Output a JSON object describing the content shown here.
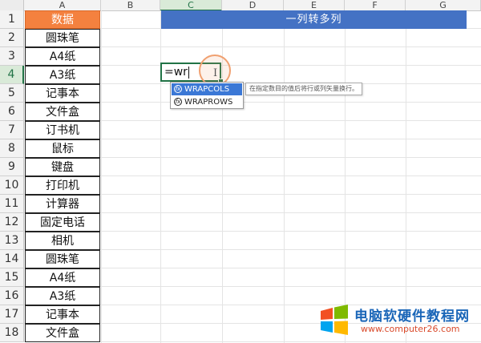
{
  "columns": [
    "A",
    "B",
    "C",
    "D",
    "E",
    "F",
    "G"
  ],
  "active_column": "C",
  "rows": [
    "1",
    "2",
    "3",
    "4",
    "5",
    "6",
    "7",
    "8",
    "9",
    "10",
    "11",
    "12",
    "13",
    "14",
    "15",
    "16",
    "17",
    "18"
  ],
  "active_row": "4",
  "column_a": [
    "数据",
    "圆珠笔",
    "A4纸",
    "A3纸",
    "记事本",
    "文件盒",
    "订书机",
    "鼠标",
    "键盘",
    "打印机",
    "计算器",
    "固定电话",
    "相机",
    "圆珠笔",
    "A4纸",
    "A3纸",
    "记事本",
    "文件盒"
  ],
  "title_bar": "一列转多列",
  "formula_input": "=wr",
  "autocomplete": {
    "items": [
      "WRAPCOLS",
      "WRAPROWS"
    ],
    "selected_index": 0,
    "icon_glyph": "fx",
    "tooltip": "在指定数目的值后将行或列矢量换行。"
  },
  "watermark": {
    "title": "电脑软硬件教程网",
    "url": "www.computer26.com"
  },
  "colors": {
    "header_fill": "#f4813f",
    "title_fill": "#4472c4",
    "active_green": "#217346",
    "selection_blue": "#3b78d6"
  },
  "icons": [
    "function-icon",
    "ibeam-cursor-icon",
    "windows-logo-icon"
  ]
}
